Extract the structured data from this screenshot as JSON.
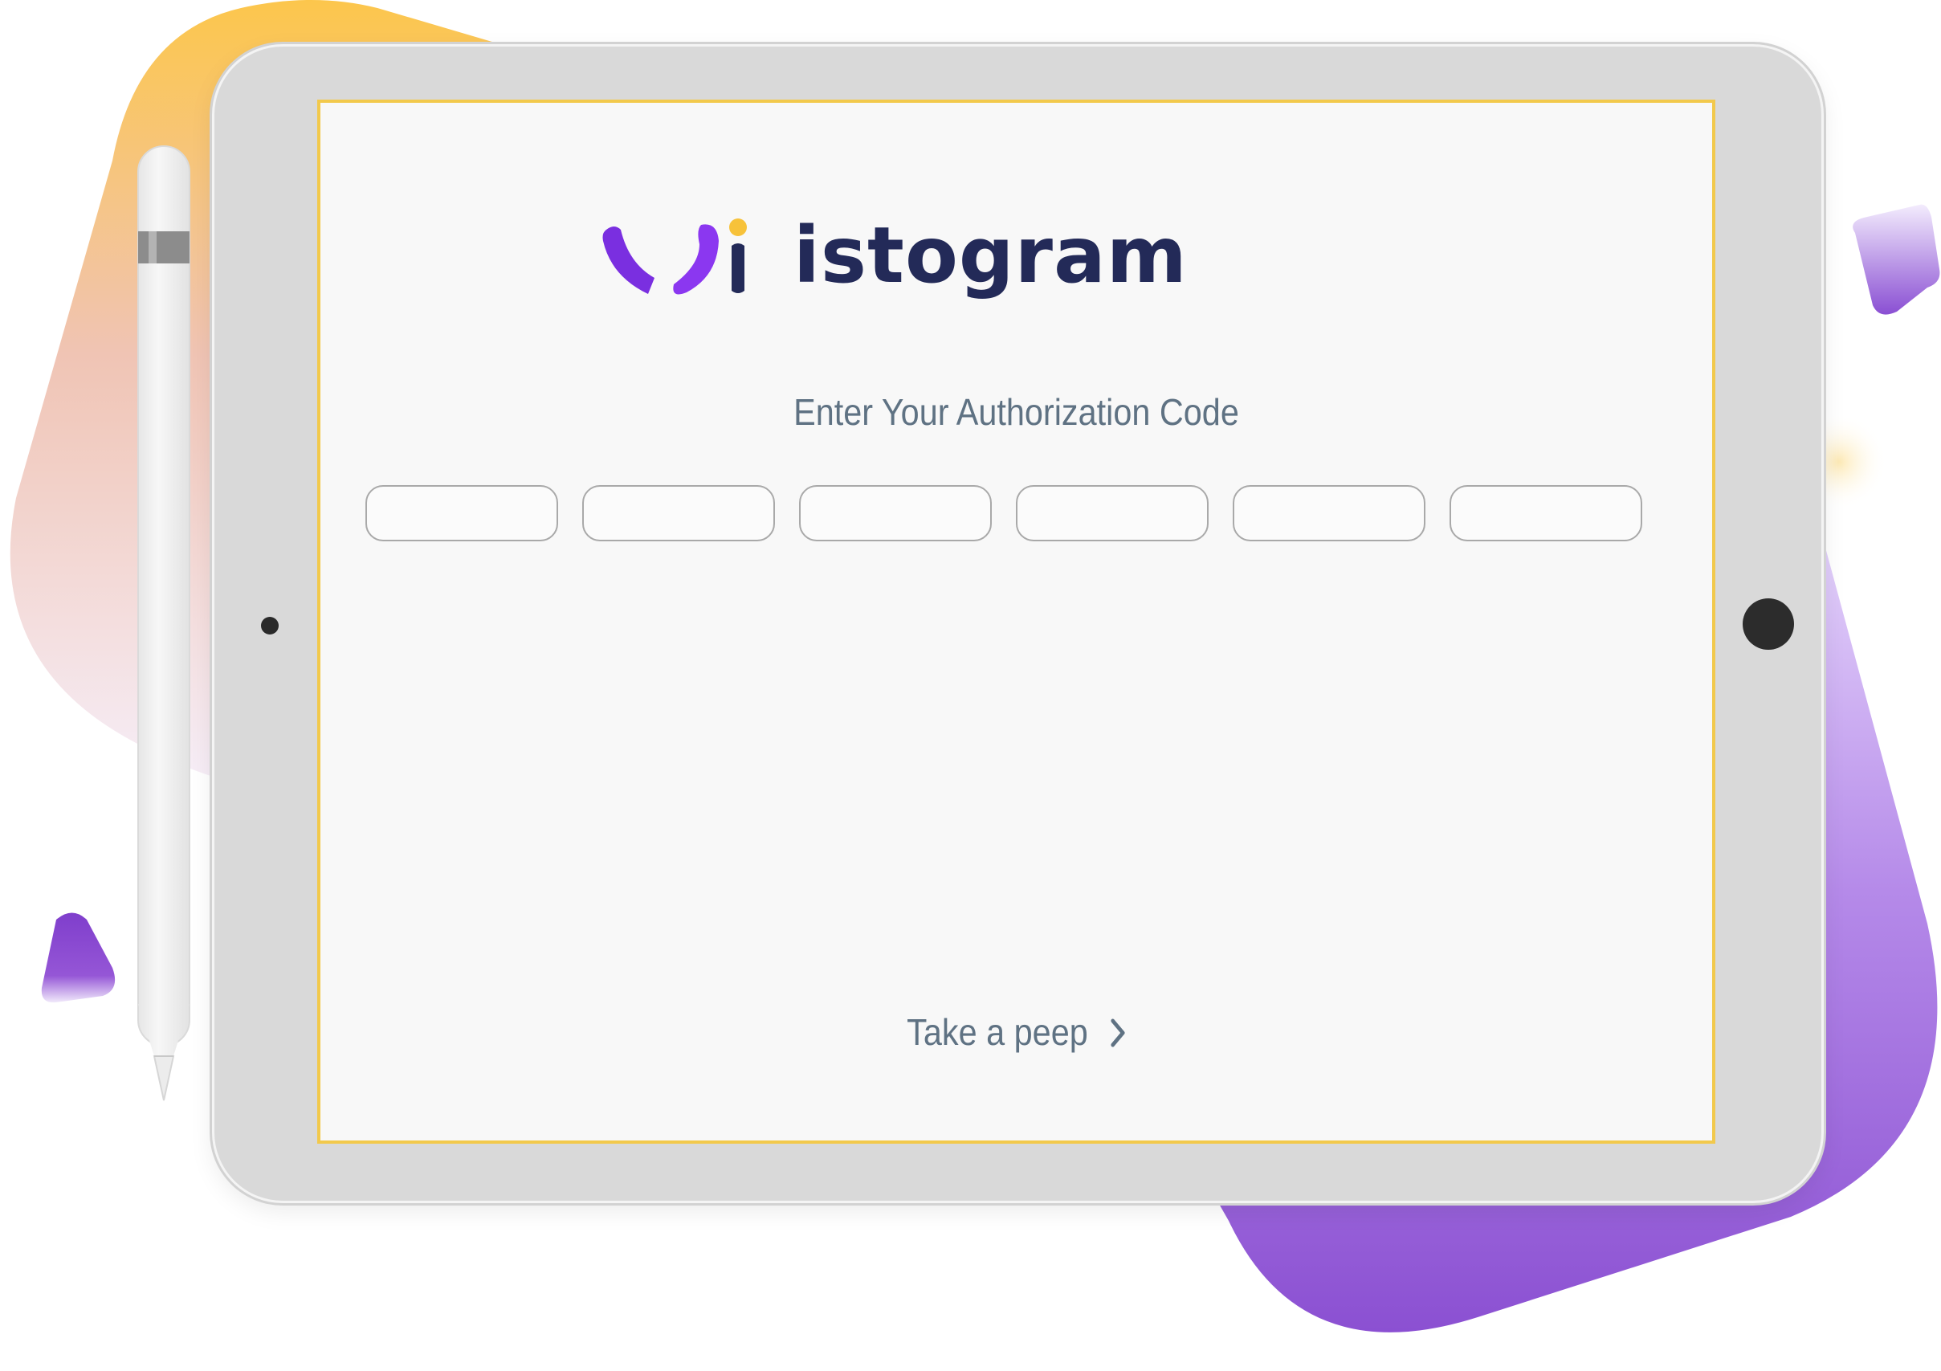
{
  "brand": {
    "name": "istogram",
    "logo_colors": {
      "mark": "#8b37f0",
      "dot": "#f7c23a",
      "wordmark": "#232a58"
    }
  },
  "auth": {
    "prompt": "Enter Your Authorization Code",
    "code_length": 6,
    "code_values": [
      "",
      "",
      "",
      "",
      "",
      ""
    ]
  },
  "footer_link": {
    "label": "Take a peep",
    "icon": "chevron-right-icon"
  },
  "colors": {
    "screen_border": "#f2c94c",
    "text_muted": "#5f7283",
    "purple_accent": "#8b37f0"
  }
}
